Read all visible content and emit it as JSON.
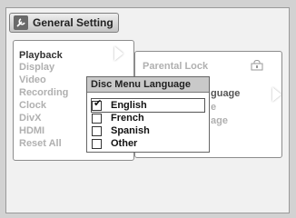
{
  "header": {
    "title": "General Setting",
    "icon": "wrench-icon"
  },
  "left_menu": {
    "items": [
      {
        "label": "Playback",
        "active": true
      },
      {
        "label": "Display",
        "active": false
      },
      {
        "label": "Video",
        "active": false
      },
      {
        "label": "Recording",
        "active": false
      },
      {
        "label": "Clock",
        "active": false
      },
      {
        "label": "DivX",
        "active": false
      },
      {
        "label": "HDMI",
        "active": false
      },
      {
        "label": "Reset All",
        "active": false
      }
    ]
  },
  "right_menu": {
    "parental_lock": "Parental Lock",
    "partial_items": [
      "guage",
      "e",
      "age"
    ]
  },
  "popup": {
    "title": "Disc Menu Language",
    "options": [
      {
        "label": "English",
        "checked": true
      },
      {
        "label": "French",
        "checked": false
      },
      {
        "label": "Spanish",
        "checked": false
      },
      {
        "label": "Other",
        "checked": false
      }
    ]
  }
}
